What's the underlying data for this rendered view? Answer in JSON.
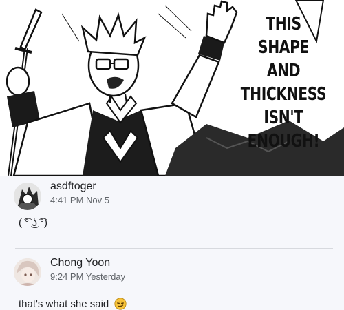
{
  "panel": {
    "caption_lines": [
      "THIS",
      "SHAPE AND",
      "THICKNESS",
      "ISN'T",
      "ENOUGH!"
    ]
  },
  "comments": [
    {
      "author": "asdftoger",
      "timestamp": "4:41 PM Nov 5",
      "text": "( ͡° ͜ʖ ͡°)",
      "avatar_icon": "manga-avatar-icon"
    },
    {
      "author": "Chong Yoon",
      "timestamp": "9:24 PM Yesterday",
      "text": "that's what she said",
      "emoji": "smirk-emoji-icon",
      "avatar_icon": "anime-avatar-icon"
    }
  ],
  "colors": {
    "comments_background": "#f6f7fb",
    "author_text": "#202124",
    "timestamp_text": "#5f6368",
    "divider": "#d7d9de",
    "emoji_face": "#f7c33b"
  }
}
